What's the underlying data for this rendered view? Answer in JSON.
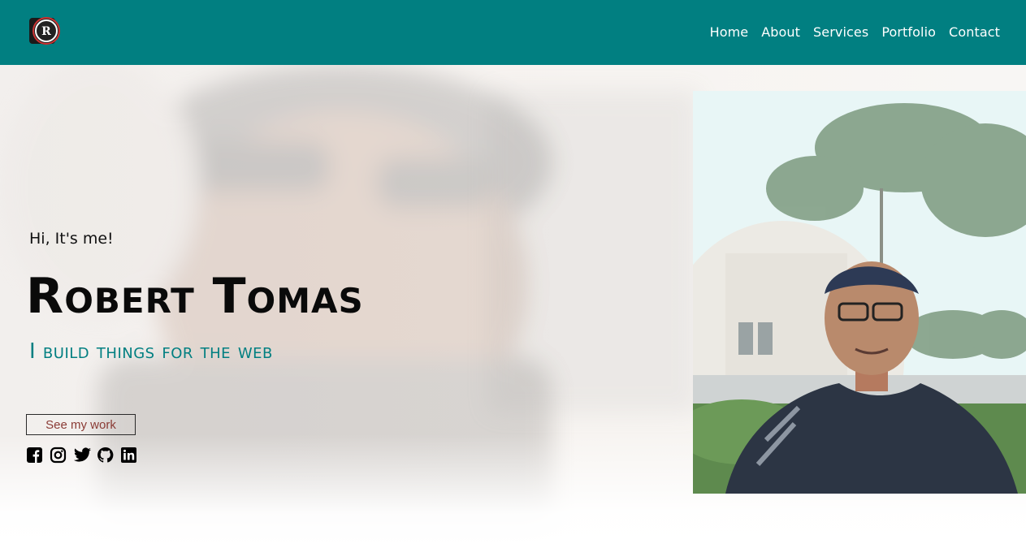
{
  "header": {
    "logo_letter": "R",
    "nav": [
      {
        "label": "Home"
      },
      {
        "label": "About"
      },
      {
        "label": "Services"
      },
      {
        "label": "Portfolio"
      },
      {
        "label": "Contact"
      }
    ]
  },
  "hero": {
    "greeting": "Hi, It's me!",
    "name": "Robert Tomas",
    "tagline": "I build things for the web",
    "cta_label": "See my work",
    "socials": [
      {
        "icon": "facebook-icon"
      },
      {
        "icon": "instagram-icon"
      },
      {
        "icon": "twitter-icon"
      },
      {
        "icon": "github-icon"
      },
      {
        "icon": "linkedin-icon"
      }
    ]
  },
  "colors": {
    "header_bg": "#017f81",
    "accent": "#017f81",
    "cta_text": "#8a3b35"
  }
}
